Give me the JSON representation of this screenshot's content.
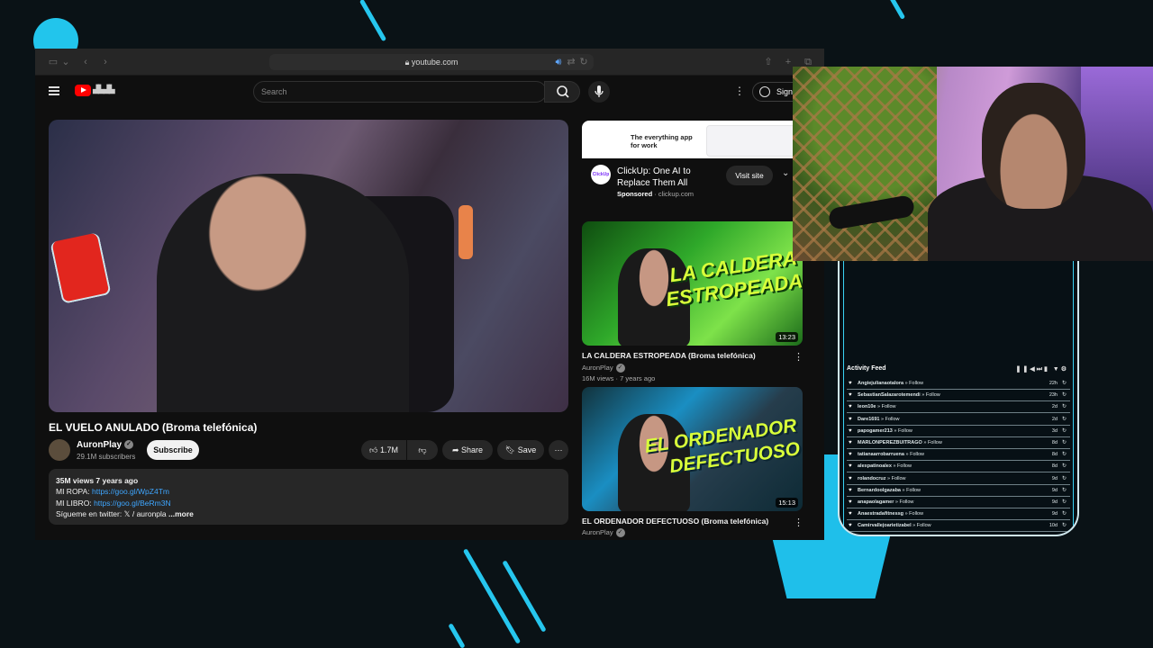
{
  "browser": {
    "url": "youtube.com"
  },
  "youtube": {
    "search_placeholder": "Search",
    "sign_in": "Sign in",
    "video": {
      "title": "EL VUELO ANULADO (Broma telefónica)",
      "channel": "AuronPlay",
      "subscribers": "29.1M subscribers",
      "subscribe": "Subscribe",
      "likes": "1.7M",
      "share": "Share",
      "save": "Save",
      "views_age": "35M views  7 years ago",
      "desc_ropa_label": "MI ROPA:",
      "desc_ropa_link": "https://goo.gl/WpZ4Tm",
      "desc_libro_label": "MI LIBRO:",
      "desc_libro_link": "https://goo.gl/BeRm3N",
      "desc_twitter": "Sígueme en twitter:",
      "desc_twitter_handle": "/ auronpla",
      "more": "...more"
    },
    "ad": {
      "image_text": "The everything app for work",
      "logo_text": "ClickUp",
      "title": "ClickUp: One AI to Replace Them All",
      "sponsored": "Sponsored",
      "domain": "clickup.com",
      "visit": "Visit site"
    },
    "recommendations": [
      {
        "thumb_text": "LA CALDERA ESTROPEADA",
        "duration": "13:23",
        "title": "LA CALDERA ESTROPEADA (Broma telefónica)",
        "channel": "AuronPlay",
        "meta": "16M views · 7 years ago"
      },
      {
        "thumb_text": "EL ORDENADOR DEFECTUOSO",
        "duration": "15:13",
        "title": "EL ORDENADOR DEFECTUOSO (Broma telefónica)",
        "channel": "AuronPlay"
      }
    ]
  },
  "activity_feed": {
    "title": "Activity Feed",
    "rows": [
      {
        "name": "Angiejulianaotalora",
        "action": "Follow",
        "time": "22h"
      },
      {
        "name": "SebastianSalazarotemendi",
        "action": "Follow",
        "time": "23h"
      },
      {
        "name": "leon10e",
        "action": "Follow",
        "time": "2d"
      },
      {
        "name": "Dare1691",
        "action": "Follow",
        "time": "2d"
      },
      {
        "name": "papogamer213",
        "action": "Follow",
        "time": "3d"
      },
      {
        "name": "MARLONPEREZBUITRAGO",
        "action": "Follow",
        "time": "8d"
      },
      {
        "name": "tatianaarrobarruena",
        "action": "Follow",
        "time": "8d"
      },
      {
        "name": "alexpatinoalex",
        "action": "Follow",
        "time": "8d"
      },
      {
        "name": "rolandocruz",
        "action": "Follow",
        "time": "9d"
      },
      {
        "name": "Bernardoolgazaba",
        "action": "Follow",
        "time": "9d"
      },
      {
        "name": "anapaolagamer",
        "action": "Follow",
        "time": "9d"
      },
      {
        "name": "Anaestradafitnessg",
        "action": "Follow",
        "time": "9d"
      },
      {
        "name": "Camirvallejoarietizabel",
        "action": "Follow",
        "time": "10d"
      }
    ]
  },
  "colors": {
    "accent": "#26c6ee",
    "background": "#0a1216",
    "yt_red": "#ff0000",
    "link": "#3ea6ff",
    "thumb1_green": "#2fa82a",
    "thumb2_blue": "#1a8ec2"
  }
}
